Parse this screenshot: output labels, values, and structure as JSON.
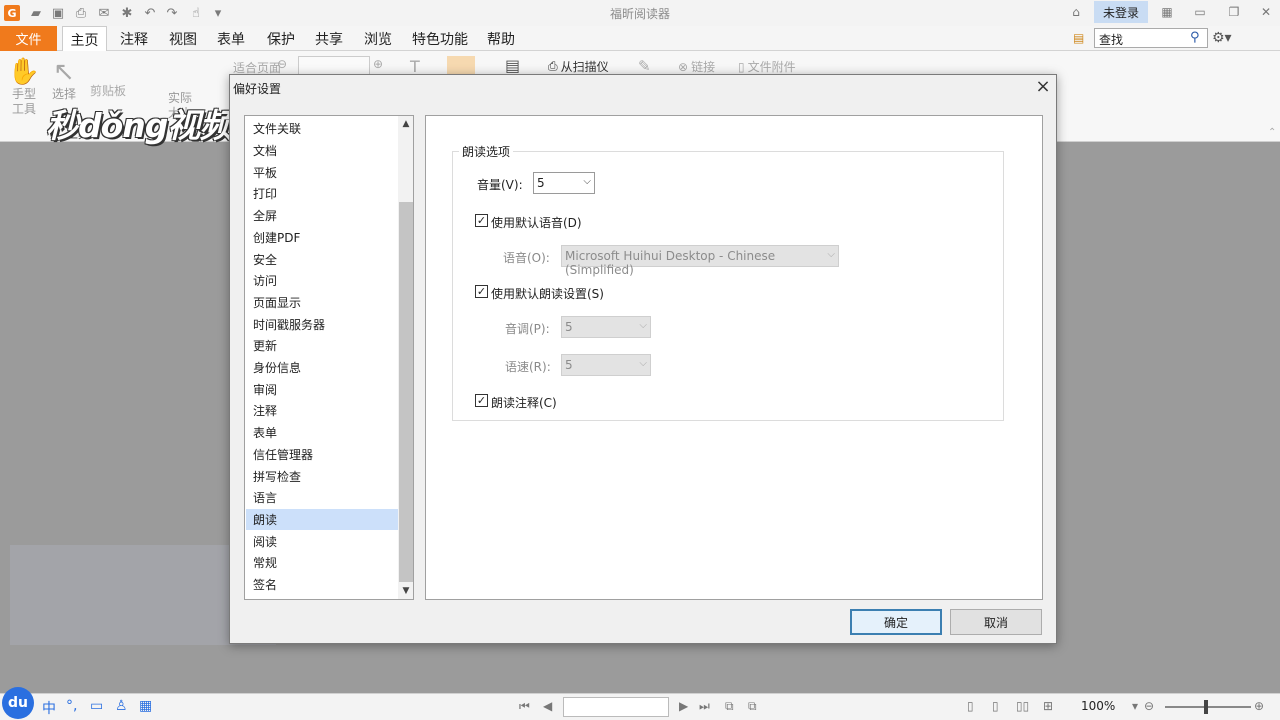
{
  "titlebar": {
    "window_title": "福昕阅读器",
    "login_label": "未登录",
    "logo_letter": "G"
  },
  "menu": {
    "file_label": "文件",
    "tabs": [
      "主页",
      "注释",
      "视图",
      "表单",
      "保护",
      "共享",
      "浏览",
      "特色功能",
      "帮助"
    ],
    "active_tab": "主页",
    "search_value": "查找"
  },
  "ribbon": {
    "hand_tool": "手型\n工具",
    "select_tool": "选择",
    "clipboard": "剪贴板",
    "actual_size": "实际\n大小",
    "fit_page": "适合页面",
    "from_scanner": "从扫描仪",
    "link": "链接",
    "file_attachment": "文件附件",
    "group_tools": "工具",
    "watermark_text": "秒dǒng视频"
  },
  "dialog": {
    "title": "偏好设置",
    "categories": [
      "文件关联",
      "文档",
      "平板",
      "打印",
      "全屏",
      "创建PDF",
      "安全",
      "访问",
      "页面显示",
      "时间戳服务器",
      "更新",
      "身份信息",
      "审阅",
      "注释",
      "表单",
      "信任管理器",
      "拼写检查",
      "语言",
      "朗读",
      "阅读",
      "常规",
      "签名"
    ],
    "selected_category": "朗读",
    "group_title": "朗读选项",
    "volume_label": "音量(V):",
    "volume_value": "5",
    "use_default_voice_label": "使用默认语音(D)",
    "use_default_voice_checked": true,
    "voice_label": "语音(O):",
    "voice_value": "Microsoft Huihui Desktop - Chinese (Simplified)",
    "use_default_read_settings_label": "使用默认朗读设置(S)",
    "use_default_read_settings_checked": true,
    "pitch_label": "音调(P):",
    "pitch_value": "5",
    "rate_label": "语速(R):",
    "rate_value": "5",
    "read_comments_label": "朗读注释(C)",
    "read_comments_checked": true,
    "ok_label": "确定",
    "cancel_label": "取消"
  },
  "statusbar": {
    "du_label": "du",
    "ime_lang": "中",
    "zoom_value": "100%"
  }
}
